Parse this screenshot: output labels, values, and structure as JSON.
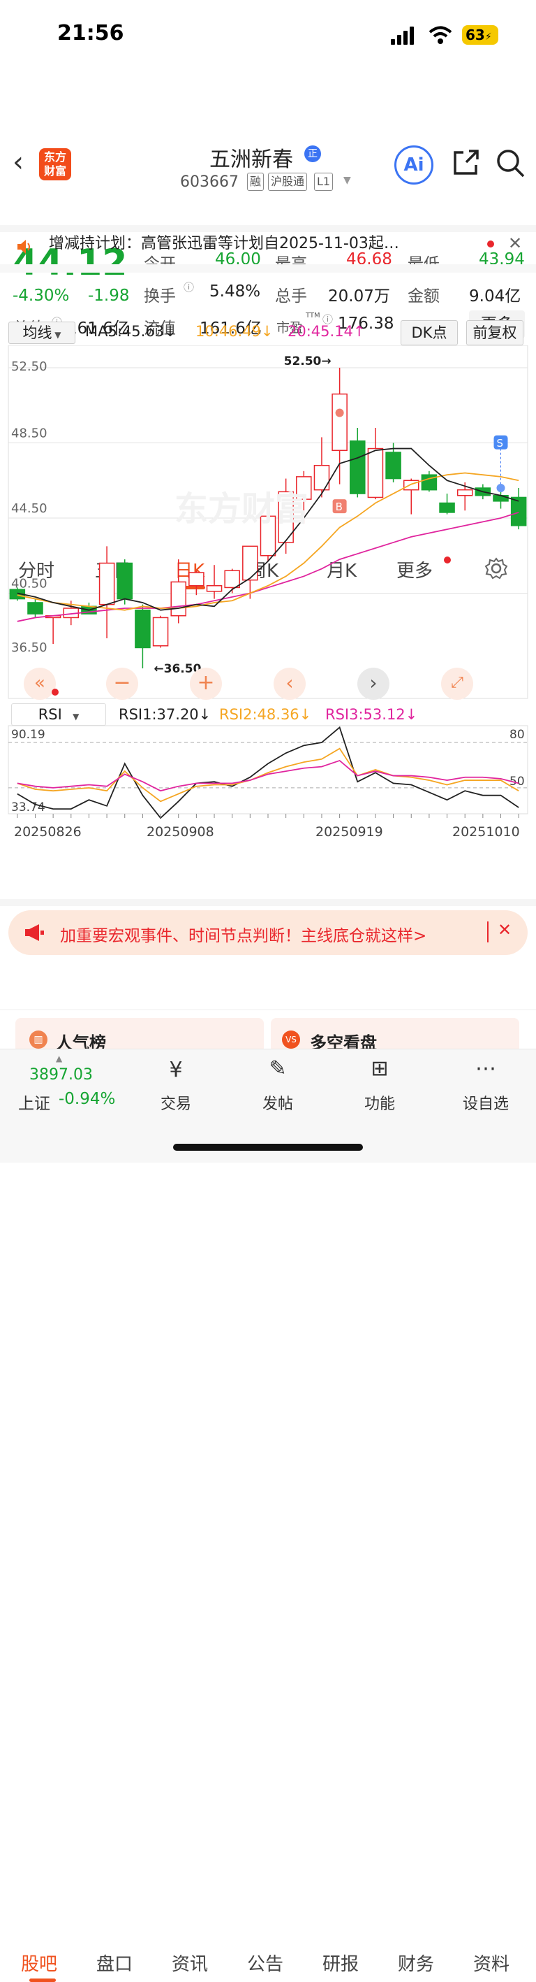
{
  "status": {
    "time": "21:56",
    "battery": "63"
  },
  "header": {
    "logo": "东方\n财富",
    "stock_name": "五洲新春",
    "badge": "正",
    "code": "603667",
    "tags": [
      "融",
      "沪股通",
      "L1"
    ],
    "ai_label": "Ai"
  },
  "quote": {
    "price": "44.12",
    "pct": "-4.30%",
    "chg": "-1.98",
    "open_label": "今开",
    "open": "46.00",
    "high_label": "最高",
    "high": "46.68",
    "low_label": "最低",
    "low": "43.94",
    "turnover_label": "换手",
    "turnover": "5.48%",
    "volume_label": "总手",
    "volume": "20.07万",
    "amount_label": "金额",
    "amount": "9.04亿",
    "mktcap_label": "总值",
    "mktcap": "161.6亿",
    "float_label": "流值",
    "float": "161.6亿",
    "pe_label": "市盈",
    "pe_sup": "TTM",
    "pe": "176.38",
    "more": "更多"
  },
  "notice": {
    "text": "增减持计划：高管张迅雷等计划自2025-11-03起…"
  },
  "ktabs": [
    "分时",
    "五日",
    "日K",
    "周K",
    "月K",
    "更多"
  ],
  "ma_bar": {
    "select": "均线",
    "ma5": "MA5:45.63↓",
    "ma10": "10:46.49↓",
    "ma20": "20:45.14↑",
    "dk": "DK点",
    "fq": "前复权"
  },
  "rsi_bar": {
    "select": "RSI",
    "rsi1": "RSI1:37.20↓",
    "rsi2": "RSI2:48.36↓",
    "rsi3": "RSI3:53.12↓"
  },
  "colors": {
    "up": "#e9262c",
    "down": "#17a533",
    "ma5": "#222222",
    "ma10": "#f5a623",
    "ma20": "#e0259e"
  },
  "chart_data": [
    {
      "type": "candlestick",
      "title": "",
      "y_ticks": [
        "52.50",
        "48.50",
        "44.50",
        "40.50",
        "36.50"
      ],
      "ylim": [
        36.5,
        52.5
      ],
      "annotations": {
        "high": "52.50→",
        "low": "←36.50",
        "buy": "B",
        "sell": "S"
      },
      "candles": [
        {
          "o": 40.7,
          "h": 40.8,
          "l": 40.1,
          "c": 40.2
        },
        {
          "o": 40.0,
          "h": 40.2,
          "l": 39.2,
          "c": 39.4
        },
        {
          "o": 39.2,
          "h": 39.3,
          "l": 37.8,
          "c": 39.3
        },
        {
          "o": 39.2,
          "h": 40.1,
          "l": 38.8,
          "c": 39.7
        },
        {
          "o": 39.8,
          "h": 40.0,
          "l": 39.4,
          "c": 39.4
        },
        {
          "o": 39.9,
          "h": 43.0,
          "l": 38.1,
          "c": 42.1
        },
        {
          "o": 42.1,
          "h": 42.3,
          "l": 39.9,
          "c": 40.2
        },
        {
          "o": 39.6,
          "h": 39.9,
          "l": 36.5,
          "c": 37.6
        },
        {
          "o": 37.7,
          "h": 39.3,
          "l": 37.6,
          "c": 39.2
        },
        {
          "o": 39.3,
          "h": 42.3,
          "l": 38.9,
          "c": 41.1
        },
        {
          "o": 40.9,
          "h": 41.7,
          "l": 40.4,
          "c": 41.6
        },
        {
          "o": 40.6,
          "h": 42.0,
          "l": 40.2,
          "c": 40.9
        },
        {
          "o": 40.8,
          "h": 41.8,
          "l": 40.5,
          "c": 41.7
        },
        {
          "o": 41.2,
          "h": 43.0,
          "l": 40.2,
          "c": 43.0
        },
        {
          "o": 42.5,
          "h": 45.3,
          "l": 42.2,
          "c": 44.6
        },
        {
          "o": 43.2,
          "h": 46.6,
          "l": 42.6,
          "c": 45.9
        },
        {
          "o": 45.5,
          "h": 47.0,
          "l": 44.2,
          "c": 46.7
        },
        {
          "o": 46.0,
          "h": 48.8,
          "l": 45.6,
          "c": 47.3
        },
        {
          "o": 48.1,
          "h": 52.5,
          "l": 46.3,
          "c": 51.1
        },
        {
          "o": 48.6,
          "h": 49.3,
          "l": 45.6,
          "c": 45.8
        },
        {
          "o": 45.6,
          "h": 49.3,
          "l": 45.5,
          "c": 48.2
        },
        {
          "o": 48.0,
          "h": 48.5,
          "l": 46.4,
          "c": 46.6
        },
        {
          "o": 46.0,
          "h": 46.6,
          "l": 44.7,
          "c": 46.5
        },
        {
          "o": 46.8,
          "h": 47.0,
          "l": 45.9,
          "c": 46.0
        },
        {
          "o": 45.3,
          "h": 45.8,
          "l": 44.7,
          "c": 44.8
        },
        {
          "o": 45.7,
          "h": 46.4,
          "l": 44.9,
          "c": 46.0
        },
        {
          "o": 46.1,
          "h": 46.3,
          "l": 45.5,
          "c": 45.7
        },
        {
          "o": 45.7,
          "h": 46.3,
          "l": 45.0,
          "c": 45.4
        },
        {
          "o": 45.6,
          "h": 46.1,
          "l": 43.9,
          "c": 44.1
        }
      ],
      "ma5": [
        40.5,
        40.3,
        40.0,
        39.8,
        39.6,
        39.9,
        40.2,
        40.0,
        39.6,
        39.7,
        39.9,
        39.8,
        40.7,
        41.3,
        42.2,
        43.3,
        44.5,
        45.8,
        47.4,
        47.7,
        48.1,
        48.2,
        48.2,
        47.3,
        46.5,
        46.2,
        45.9,
        45.7,
        45.4
      ],
      "ma10": [
        40.4,
        40.2,
        40.0,
        39.9,
        39.8,
        39.7,
        39.6,
        39.8,
        39.7,
        39.7,
        39.8,
        40.0,
        40.1,
        40.5,
        40.9,
        41.4,
        42.1,
        43.0,
        44.0,
        44.6,
        45.3,
        45.8,
        46.3,
        46.6,
        46.8,
        46.9,
        46.8,
        46.7,
        46.5
      ],
      "ma20": [
        39.0,
        39.2,
        39.3,
        39.4,
        39.5,
        39.6,
        39.7,
        39.7,
        39.7,
        39.8,
        39.9,
        40.1,
        40.3,
        40.5,
        40.8,
        41.1,
        41.4,
        41.8,
        42.3,
        42.6,
        42.9,
        43.2,
        43.5,
        43.7,
        43.9,
        44.1,
        44.3,
        44.5,
        44.8
      ]
    },
    {
      "type": "line",
      "title": "RSI",
      "y_ticks": [
        "90.19",
        "33.74"
      ],
      "ref_lines": [
        "80",
        "50"
      ],
      "ylim": [
        33.74,
        90.19
      ],
      "x_labels": [
        "20250826",
        "20250908",
        "20250919",
        "20251010"
      ],
      "series": [
        {
          "name": "RSI1",
          "values": [
            46,
            39,
            36,
            36,
            42,
            38,
            66,
            45,
            30,
            41,
            53,
            54,
            51,
            57,
            66,
            73,
            78,
            80,
            90,
            54,
            60,
            53,
            52,
            47,
            42,
            48,
            45,
            45,
            37
          ]
        },
        {
          "name": "RSI2",
          "values": [
            53,
            49,
            48,
            49,
            50,
            48,
            61,
            50,
            41,
            46,
            51,
            52,
            52,
            55,
            60,
            64,
            67,
            69,
            76,
            58,
            62,
            58,
            57,
            55,
            52,
            55,
            55,
            55,
            48
          ]
        },
        {
          "name": "RSI3",
          "values": [
            53,
            51,
            50,
            51,
            52,
            51,
            59,
            54,
            48,
            51,
            53,
            53,
            53,
            55,
            59,
            61,
            63,
            64,
            68,
            58,
            61,
            58,
            58,
            57,
            55,
            57,
            57,
            56,
            53
          ]
        }
      ]
    }
  ],
  "banner": {
    "text": "加重要宏观事件、时间节点判断！主线底仓就这样>"
  },
  "btabs": [
    "股吧",
    "盘口",
    "资讯",
    "公告",
    "研报",
    "财务",
    "资料"
  ],
  "cards": {
    "left": "人气榜",
    "right": "多空看盘"
  },
  "bottom_nav": {
    "index_value": "3897.03",
    "index_name": "上证",
    "index_pct": "-0.94%",
    "items": [
      "交易",
      "发帖",
      "功能",
      "设自选"
    ]
  }
}
